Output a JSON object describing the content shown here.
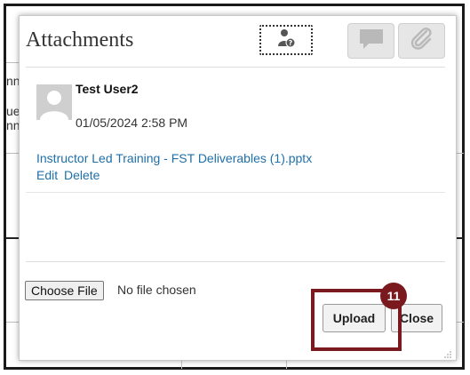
{
  "dialog": {
    "title": "Attachments",
    "toolbar": {
      "person_help_icon": "person-help-icon",
      "comment_icon": "comment-icon",
      "paperclip_icon": "paperclip-icon"
    },
    "attachment": {
      "user": "Test User2",
      "timestamp": "01/05/2024 2:58 PM",
      "file_name": "Instructor Led Training - FST Deliverables (1).pptx",
      "edit_label": "Edit",
      "delete_label": "Delete"
    },
    "file_input": {
      "button_label": "Choose File",
      "status_text": "No file chosen"
    },
    "buttons": {
      "upload": "Upload",
      "close": "Close"
    }
  },
  "callout": {
    "step_number": "11",
    "color": "#7a1a1f"
  },
  "background_fragments": {
    "frag_1": "nn",
    "frag_2": "ue",
    "frag_3": "nn"
  },
  "colors": {
    "link": "#1f6fa8",
    "toolbar_button_bg": "#e6e6e6"
  }
}
